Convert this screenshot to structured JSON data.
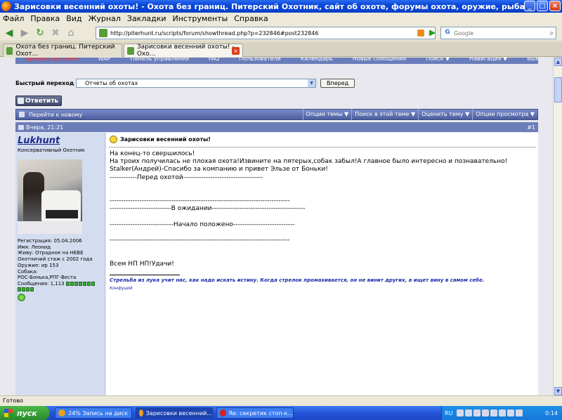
{
  "window": {
    "title": "Зарисовки весенний охоты! - Охота без границ. Питерский Охотник, сайт об охоте, форумы охота, оружие, рыбалка, собаки, патроны, животные, электронная б...",
    "buttons": {
      "minimize": "_",
      "maximize": "□",
      "close": "×"
    }
  },
  "menu": [
    "Файл",
    "Правка",
    "Вид",
    "Журнал",
    "Закладки",
    "Инструменты",
    "Справка"
  ],
  "navbar": {
    "url": "http://piterhunt.ru/scripts/forum/showthread.php?p=232846#post232846",
    "search_placeholder": "Google"
  },
  "tabs": [
    {
      "label": "Охота без границ. Питерский Охот...",
      "active": false
    },
    {
      "label": "Зарисовки весенний охоты! - Охо...",
      "active": true
    }
  ],
  "forum_nav": [
    "Правила форумов",
    "WAP",
    "Панель управления",
    "FAQ",
    "Пользователи",
    "Календарь",
    "Новые сообщения",
    "Поиск ▼",
    "Навигация ▼",
    "Выход"
  ],
  "quickjump": {
    "label": "Быстрый переход",
    "selected": "Отчеты об охотах",
    "go": "Вперед"
  },
  "reply_button": "Ответить",
  "thread_bar": {
    "go_new": "Перейти к новому",
    "options": [
      "Опции темы ▼",
      "Поиск в этой теме ▼",
      "Оценить тему ▼",
      "Опции просмотра ▼"
    ]
  },
  "post": {
    "date": "Вчера, 21:21",
    "number": "#1",
    "title": "Зарисовки весенний охоты!",
    "body": "На конец-то свершилось!\nНа троих получилась не плохая охота!Извините на пятерых,собак забыл!А главное было интересно и познавательно!\nStalker(Андрей)-Спасибо за компанию и привет Эльзе от Боньки!\n------------Перед охотой-----------------------------------\n\n\n-------------------------------------------------------------------------------\n---------------------------В ожидании-----------------------------------------\n\n----------------------------Начало положено---------------------------\n\n-------------------------------------------------------------------------------\n\n\nВсем НП НП!Удачи!",
    "signature": "Стрельба из лука учит нас, как надо искать истину. Когда стрелок промахивается, он не винит других, а ищет вину в самом себе.",
    "signature_author": "Конфуций"
  },
  "user": {
    "name": "Lukhunt",
    "title": "Консервативный Охотник",
    "info": [
      "Регистрация: 05.04.2006",
      "Имя: Леонид",
      "Живу: Отрадное на НЕВЕ",
      "Охотничий стаж с 2002 года",
      "Оружие: ир 153",
      "Собака:",
      "РОС-Бонька,РПГ-Веста"
    ],
    "messages": "Сообщения: 1,113"
  },
  "statusbar": "Готово",
  "taskbar": {
    "start": "пуск",
    "tasks": [
      {
        "label": "24% Запись на диск",
        "active": false
      },
      {
        "label": "Зарисовки весенний...",
        "active": true
      },
      {
        "label": "Re: секретик стоп-к...",
        "active": false
      }
    ],
    "lang": "RU",
    "clock": "0:14"
  },
  "colors": {
    "accent": "#6c7eba",
    "link": "#1c2a8c",
    "rules_link": "#ff3030"
  }
}
